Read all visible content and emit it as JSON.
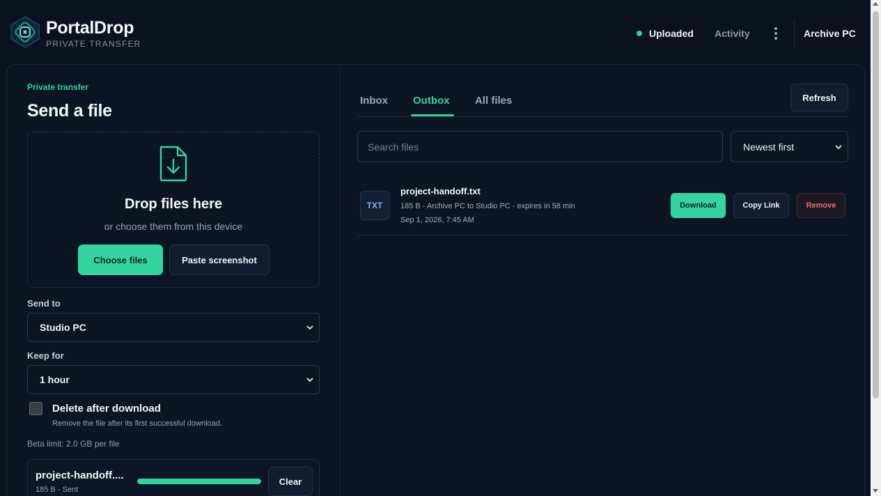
{
  "brand": {
    "name": "PortalDrop",
    "tagline": "PRIVATE TRANSFER",
    "accent_color": "#35d39f"
  },
  "header": {
    "status_label": "Uploaded",
    "activity_label": "Activity",
    "device_name": "Archive PC",
    "more_icon": "more-vertical-icon"
  },
  "send": {
    "eyebrow": "Private transfer",
    "title": "Send a file",
    "dropzone": {
      "icon": "file-download-icon",
      "title": "Drop files here",
      "subtitle": "or choose them from this device",
      "choose_label": "Choose files",
      "paste_label": "Paste screenshot"
    },
    "send_to": {
      "label": "Send to",
      "value": "Studio PC"
    },
    "keep_for": {
      "label": "Keep for",
      "value": "1 hour"
    },
    "delete_after": {
      "checked": false,
      "label": "Delete after download",
      "help": "Remove the file after its first successful download."
    },
    "beta_limit": "Beta limit: 2.0 GB per file",
    "upload": {
      "name": "project-handoff....",
      "meta": "185 B - Sent",
      "progress": 1.0,
      "clear_label": "Clear"
    }
  },
  "files": {
    "tabs": [
      {
        "label": "Inbox",
        "active": false
      },
      {
        "label": "Outbox",
        "active": true
      },
      {
        "label": "All files",
        "active": false
      }
    ],
    "refresh_label": "Refresh",
    "search_placeholder": "Search files",
    "sort_value": "Newest first",
    "items": [
      {
        "badge": "TXT",
        "name": "project-handoff.txt",
        "meta": "185 B - Archive PC to Studio PC - expires in 58 min",
        "date": "Sep 1, 2026, 7:45 AM",
        "download_label": "Download",
        "copy_label": "Copy Link",
        "remove_label": "Remove"
      }
    ]
  }
}
